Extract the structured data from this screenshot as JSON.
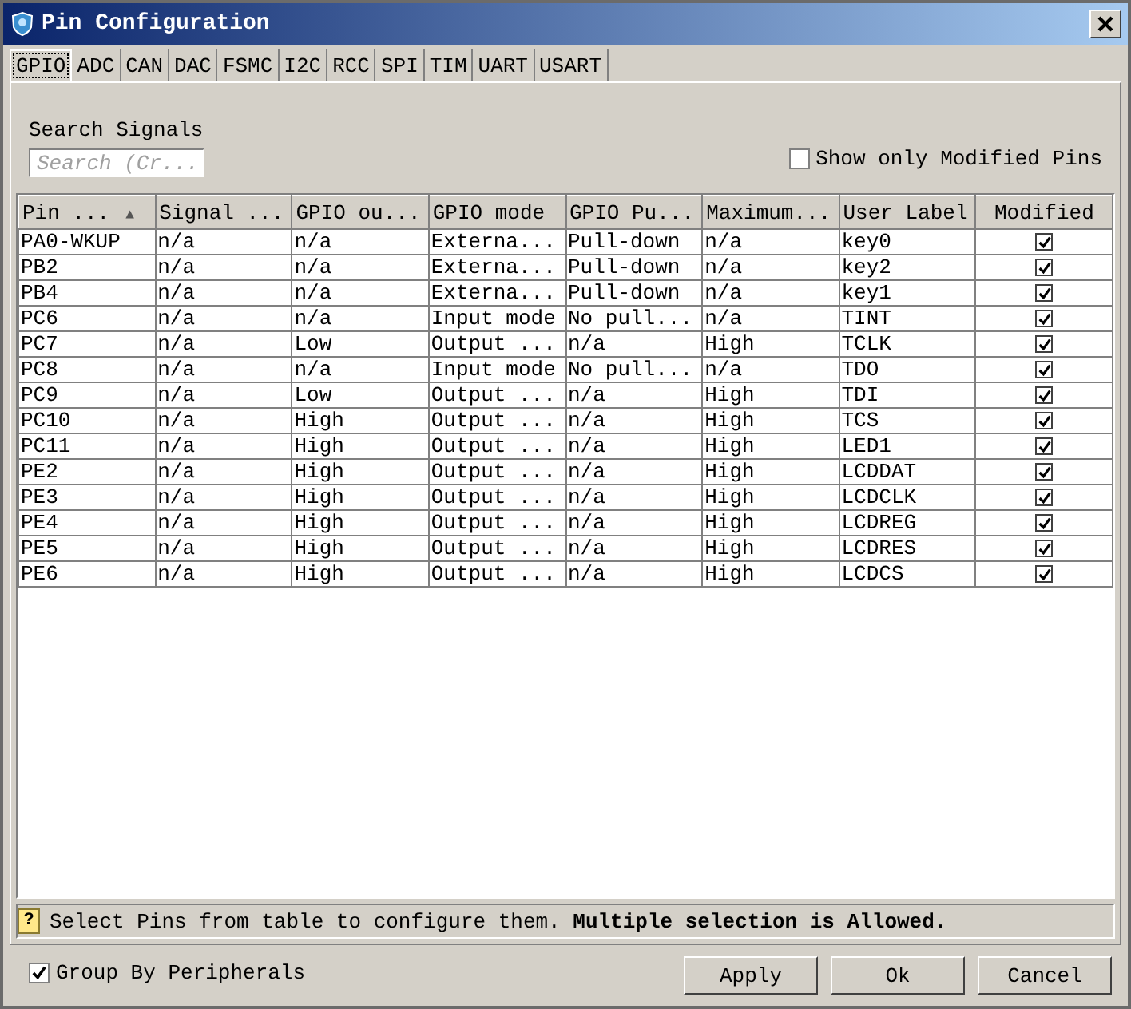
{
  "window": {
    "title": "Pin Configuration"
  },
  "tabs": [
    {
      "label": "GPIO",
      "selected": true
    },
    {
      "label": "ADC",
      "selected": false
    },
    {
      "label": "CAN",
      "selected": false
    },
    {
      "label": "DAC",
      "selected": false
    },
    {
      "label": "FSMC",
      "selected": false
    },
    {
      "label": "I2C",
      "selected": false
    },
    {
      "label": "RCC",
      "selected": false
    },
    {
      "label": "SPI",
      "selected": false
    },
    {
      "label": "TIM",
      "selected": false
    },
    {
      "label": "UART",
      "selected": false
    },
    {
      "label": "USART",
      "selected": false
    }
  ],
  "search": {
    "label": "Search Signals",
    "placeholder": "Search (Cr..."
  },
  "show_only_modified": {
    "label": "Show only Modified Pins",
    "checked": false
  },
  "table": {
    "columns": [
      {
        "label": "Pin ...",
        "sort_indicator": "▲"
      },
      {
        "label": "Signal ..."
      },
      {
        "label": "GPIO ou..."
      },
      {
        "label": "GPIO mode"
      },
      {
        "label": "GPIO Pu..."
      },
      {
        "label": "Maximum..."
      },
      {
        "label": "User Label"
      },
      {
        "label": "Modified"
      }
    ],
    "rows": [
      {
        "cells": [
          "PA0-WKUP",
          "n/a",
          "n/a",
          "Externa...",
          "Pull-down",
          "n/a",
          "key0"
        ],
        "modified": true
      },
      {
        "cells": [
          "PB2",
          "n/a",
          "n/a",
          "Externa...",
          "Pull-down",
          "n/a",
          "key2"
        ],
        "modified": true
      },
      {
        "cells": [
          "PB4",
          "n/a",
          "n/a",
          "Externa...",
          "Pull-down",
          "n/a",
          "key1"
        ],
        "modified": true
      },
      {
        "cells": [
          "PC6",
          "n/a",
          "n/a",
          "Input mode",
          "No pull...",
          "n/a",
          "TINT"
        ],
        "modified": true
      },
      {
        "cells": [
          "PC7",
          "n/a",
          "Low",
          "Output ...",
          "n/a",
          "High",
          "TCLK"
        ],
        "modified": true
      },
      {
        "cells": [
          "PC8",
          "n/a",
          "n/a",
          "Input mode",
          "No pull...",
          "n/a",
          "TDO"
        ],
        "modified": true
      },
      {
        "cells": [
          "PC9",
          "n/a",
          "Low",
          "Output ...",
          "n/a",
          "High",
          "TDI"
        ],
        "modified": true
      },
      {
        "cells": [
          "PC10",
          "n/a",
          "High",
          "Output ...",
          "n/a",
          "High",
          "TCS"
        ],
        "modified": true
      },
      {
        "cells": [
          "PC11",
          "n/a",
          "High",
          "Output ...",
          "n/a",
          "High",
          "LED1"
        ],
        "modified": true
      },
      {
        "cells": [
          "PE2",
          "n/a",
          "High",
          "Output ...",
          "n/a",
          "High",
          "LCDDAT"
        ],
        "modified": true
      },
      {
        "cells": [
          "PE3",
          "n/a",
          "High",
          "Output ...",
          "n/a",
          "High",
          "LCDCLK"
        ],
        "modified": true
      },
      {
        "cells": [
          "PE4",
          "n/a",
          "High",
          "Output ...",
          "n/a",
          "High",
          "LCDREG"
        ],
        "modified": true
      },
      {
        "cells": [
          "PE5",
          "n/a",
          "High",
          "Output ...",
          "n/a",
          "High",
          "LCDRES"
        ],
        "modified": true
      },
      {
        "cells": [
          "PE6",
          "n/a",
          "High",
          "Output ...",
          "n/a",
          "High",
          "LCDCS"
        ],
        "modified": true
      }
    ]
  },
  "hint": {
    "icon": "?",
    "text": "Select Pins from table to configure them. **Multiple selection is Allowed.**"
  },
  "group_by_peripherals": {
    "label": "Group By Peripherals",
    "checked": true
  },
  "buttons": [
    "Apply",
    "Ok",
    "Cancel"
  ]
}
